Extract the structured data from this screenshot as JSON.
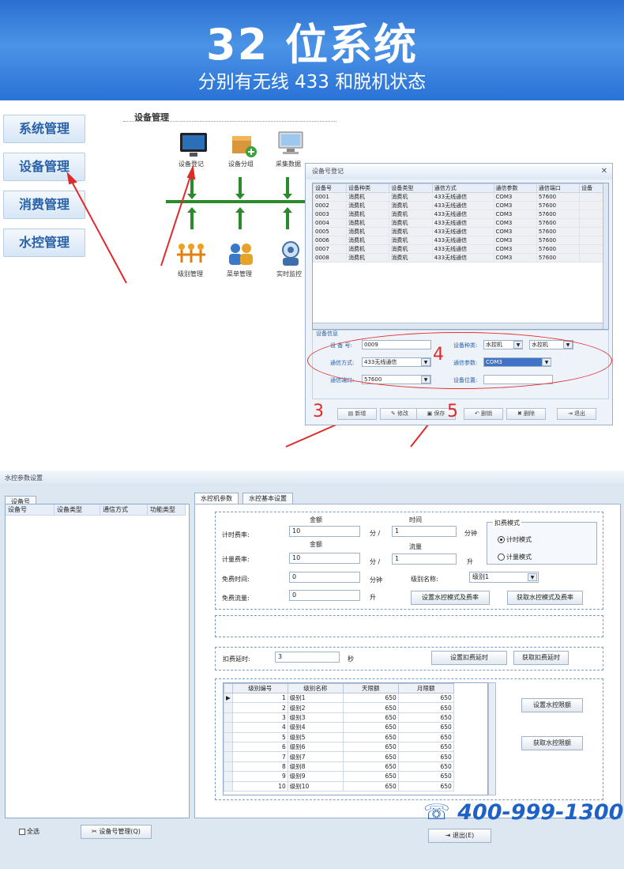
{
  "banner": {
    "title": "32 位系统",
    "subtitle": "分别有无线 433 和脱机状态"
  },
  "nav": [
    "系统管理",
    "设备管理",
    "消费管理",
    "水控管理"
  ],
  "flow": {
    "title": "设备管理",
    "top": [
      "设备登记",
      "设备分组",
      "采集数据"
    ],
    "bottom": [
      "级别管理",
      "菜单管理",
      "实时监控"
    ]
  },
  "dialog": {
    "title": "设备号登记",
    "columns": [
      "设备号",
      "设备种类",
      "设备类型",
      "通信方式",
      "通信参数",
      "通信端口",
      "设备"
    ],
    "rows": [
      [
        "0001",
        "消费机",
        "消费机",
        "433无线通信",
        "COM3",
        "57600"
      ],
      [
        "0002",
        "消费机",
        "消费机",
        "433无线通信",
        "COM3",
        "57600"
      ],
      [
        "0003",
        "消费机",
        "消费机",
        "433无线通信",
        "COM3",
        "57600"
      ],
      [
        "0004",
        "消费机",
        "消费机",
        "433无线通信",
        "COM3",
        "57600"
      ],
      [
        "0005",
        "消费机",
        "消费机",
        "433无线通信",
        "COM3",
        "57600"
      ],
      [
        "0006",
        "消费机",
        "消费机",
        "433无线通信",
        "COM3",
        "57600"
      ],
      [
        "0007",
        "消费机",
        "消费机",
        "433无线通信",
        "COM3",
        "57600"
      ],
      [
        "0008",
        "消费机",
        "消费机",
        "433无线通信",
        "COM3",
        "57600"
      ]
    ],
    "info": {
      "legend": "设备信息",
      "device_no_label": "设 备 号:",
      "device_no": "0009",
      "kind_label": "设备种类:",
      "kind1": "水控机",
      "kind2": "水控机",
      "mode_label": "通信方式:",
      "mode": "433无线通信",
      "param_label": "通信参数:",
      "param": "COM3",
      "port_label": "通信端口:",
      "port": "57600",
      "loc_label": "设备位置:",
      "loc": ""
    },
    "buttons": [
      "新增",
      "修改",
      "保存",
      "删销",
      "删除",
      "退出"
    ]
  },
  "markers": {
    "n3": "3",
    "n4": "4",
    "n5": "5"
  },
  "water": {
    "title": "水控参数设置",
    "left_tab": "设备号",
    "left_cols": [
      "设备号",
      "设备类型",
      "通信方式",
      "功能类型"
    ],
    "tabs": [
      "水控机参数",
      "水控基本设置"
    ],
    "select_all": "全选",
    "dev_btn": "设备号管理(Q)",
    "exit_btn": "退出(E)",
    "fee": {
      "money_h": "金额",
      "time_h": "时间",
      "money_h2": "金额",
      "flow_h": "流量",
      "time_rate_label": "计时费率:",
      "time_money": "10",
      "div": "分 /",
      "time_val": "1",
      "min": "分钟",
      "flow_rate_label": "计量费率:",
      "flow_money": "10",
      "flow_div": "分 /",
      "flow_val": "1",
      "sheng": "升",
      "free_time_label": "免费时间:",
      "free_time": "0",
      "free_time_unit": "分钟",
      "free_flow_label": "免费流量:",
      "free_flow": "0",
      "free_flow_unit": "升",
      "level_label": "级别名称:",
      "level": "级别1",
      "mode_title": "扣费模式",
      "mode1": "计时模式",
      "mode2": "计量模式",
      "btn_set": "设置水控模式及费率",
      "btn_get": "获取水控模式及费率"
    },
    "delay": {
      "label": "扣费延时:",
      "value": "3",
      "unit": "秒",
      "btn_set": "设置扣费延时",
      "btn_get": "获取扣费延时"
    },
    "levels": {
      "cols": [
        "级别编号",
        "级别名称",
        "天限额",
        "月限额"
      ],
      "rows": [
        [
          "1",
          "级别1",
          "650",
          "650"
        ],
        [
          "2",
          "级别2",
          "650",
          "650"
        ],
        [
          "3",
          "级别3",
          "650",
          "650"
        ],
        [
          "4",
          "级别4",
          "650",
          "650"
        ],
        [
          "5",
          "级别5",
          "650",
          "650"
        ],
        [
          "6",
          "级别6",
          "650",
          "650"
        ],
        [
          "7",
          "级别7",
          "650",
          "650"
        ],
        [
          "8",
          "级别8",
          "650",
          "650"
        ],
        [
          "9",
          "级别9",
          "650",
          "650"
        ],
        [
          "10",
          "级别10",
          "650",
          "650"
        ]
      ],
      "btn_set": "设置水控限额",
      "btn_get": "获取水控限额"
    }
  },
  "phone": "400-999-1300"
}
